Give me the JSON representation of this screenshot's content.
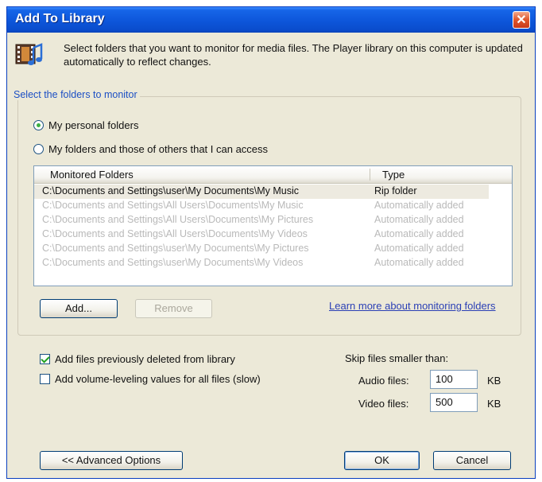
{
  "window": {
    "title": "Add To Library",
    "close_glyph": "✕"
  },
  "header": {
    "icon": "media-library-icon",
    "description": "Select folders that you want to monitor for media files. The Player library on this computer is updated automatically to reflect changes."
  },
  "monitor_group": {
    "legend": "Select the folders to monitor",
    "options": [
      {
        "label": "My personal folders",
        "checked": true
      },
      {
        "label": "My folders and those of others that I can access",
        "checked": false
      }
    ]
  },
  "folders_table": {
    "columns": [
      "Monitored Folders",
      "Type"
    ],
    "rows": [
      {
        "path": "C:\\Documents and Settings\\user\\My Documents\\My Music",
        "type": "Rip folder",
        "enabled": true
      },
      {
        "path": "C:\\Documents and Settings\\All Users\\Documents\\My Music",
        "type": "Automatically added",
        "enabled": false
      },
      {
        "path": "C:\\Documents and Settings\\All Users\\Documents\\My Pictures",
        "type": "Automatically added",
        "enabled": false
      },
      {
        "path": "C:\\Documents and Settings\\All Users\\Documents\\My Videos",
        "type": "Automatically added",
        "enabled": false
      },
      {
        "path": "C:\\Documents and Settings\\user\\My Documents\\My Pictures",
        "type": "Automatically added",
        "enabled": false
      },
      {
        "path": "C:\\Documents and Settings\\user\\My Documents\\My Videos",
        "type": "Automatically added",
        "enabled": false
      }
    ]
  },
  "buttons": {
    "add": "Add...",
    "remove": "Remove",
    "advanced": "<< Advanced Options",
    "ok": "OK",
    "cancel": "Cancel"
  },
  "learn_more": "Learn more about monitoring folders",
  "options": {
    "add_deleted": {
      "label": "Add files previously deleted from library",
      "checked": true
    },
    "volume_leveling": {
      "label": "Add volume-leveling values for all files (slow)",
      "checked": false
    }
  },
  "skip": {
    "title": "Skip files smaller than:",
    "audio_label": "Audio files:",
    "audio_value": "100",
    "audio_unit": "KB",
    "video_label": "Video files:",
    "video_value": "500",
    "video_unit": "KB"
  }
}
